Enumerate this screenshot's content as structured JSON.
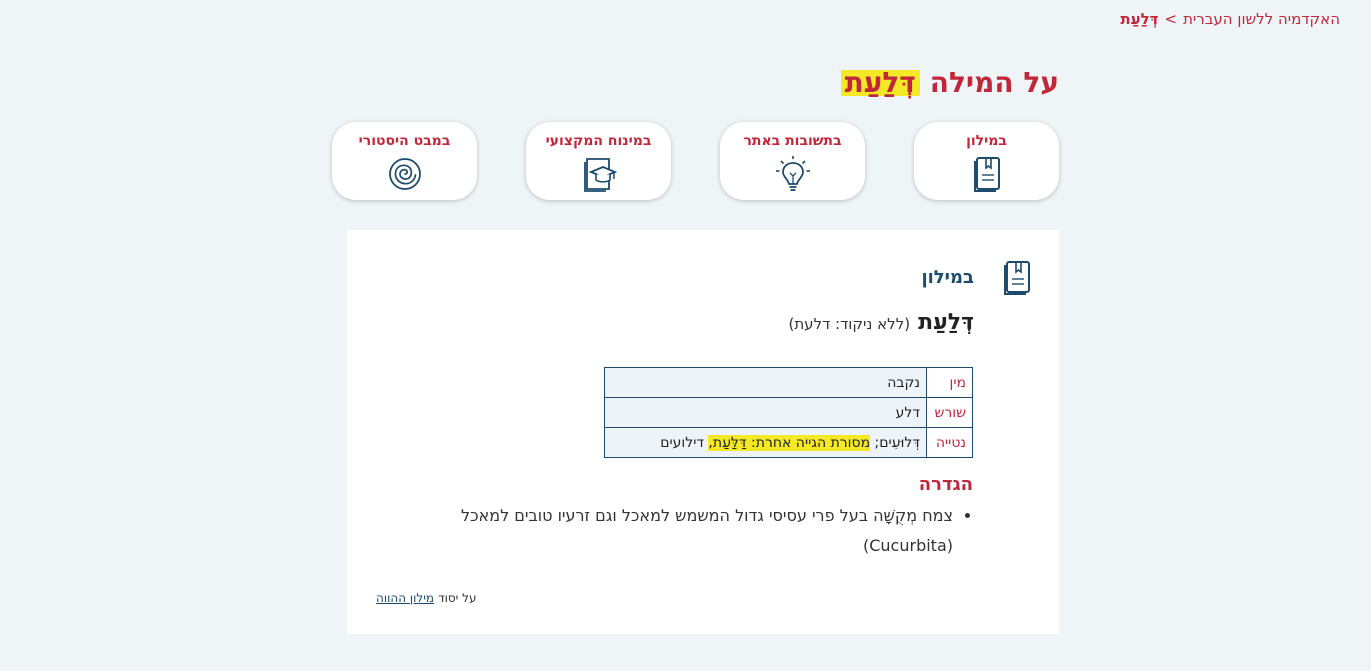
{
  "breadcrumb": {
    "parent": "האקדמיה ללשון העברית",
    "separator": ">",
    "current": "דְּלַעַת"
  },
  "title": {
    "prefix": "על המילה",
    "word": "דְּלַעַת"
  },
  "nav_cards": [
    {
      "label": "במילון",
      "icon": "dictionary-book-icon"
    },
    {
      "label": "בתשובות באתר",
      "icon": "lightbulb-icon"
    },
    {
      "label": "במינוח המקצועי",
      "icon": "graduation-cap-icon"
    },
    {
      "label": "במבט היסטורי",
      "icon": "spiral-icon"
    }
  ],
  "section": {
    "title": "במילון",
    "icon": "dictionary-book-icon",
    "entry_word": "דְּלַעַת",
    "entry_plain": "(ללא ניקוד: דלעת)",
    "table": {
      "rows": [
        {
          "key": "מין",
          "value": "נקבה"
        },
        {
          "key": "שורש",
          "value": "דלע"
        },
        {
          "key": "נטייה",
          "value_start": "דְּלוּעִים;",
          "value_highlight": "מסורת הגייה אחרת: דַּלַּעַת,",
          "value_end": "דילועים"
        }
      ]
    },
    "definition_title": "הגדרה",
    "definitions": [
      "צמח מְקֻשָּׁה בעל פרי עסיסי גדול המשמש למאכל וגם זרעיו טובים למאכל (Cucurbita)"
    ],
    "source_prefix": "על יסוד",
    "source_link": "מילון ההווה"
  },
  "colors": {
    "accent": "#c0283a",
    "navy": "#1d4b6e",
    "highlight": "#f4e827",
    "background": "#eff4f6"
  }
}
